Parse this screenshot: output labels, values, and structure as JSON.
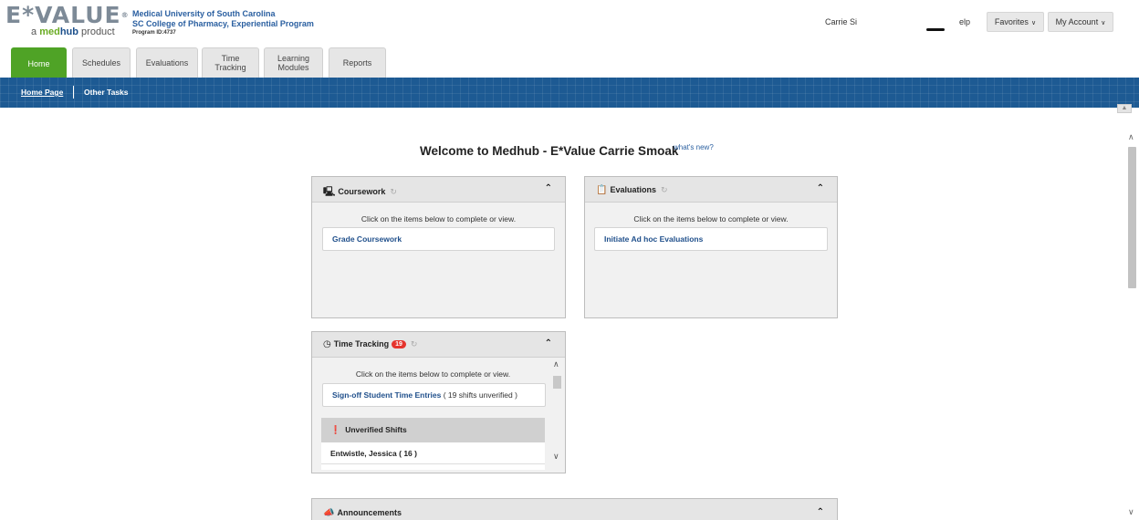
{
  "header": {
    "logo": {
      "main": "E*VALUE",
      "tm": "®",
      "sub_prefix": "a ",
      "sub_med": "med",
      "sub_hub": "hub",
      "sub_suffix": " product"
    },
    "org": {
      "line1": "Medical University of South Carolina",
      "line2": "SC College of Pharmacy, Experiential Program",
      "line3": "Program ID:4737"
    },
    "user_name": "Carrie Si",
    "help_label": "elp",
    "favorites_label": "Favorites",
    "account_label": "My Account"
  },
  "tabs": [
    {
      "label": "Home",
      "active": true
    },
    {
      "label": "Schedules"
    },
    {
      "label": "Evaluations"
    },
    {
      "label": "Time Tracking"
    },
    {
      "label": "Learning Modules"
    },
    {
      "label": "Reports"
    }
  ],
  "subnav": {
    "home_page": "Home Page",
    "other_tasks": "Other Tasks"
  },
  "welcome": {
    "title": "Welcome to Medhub - E*Value Carrie Smoak",
    "whats_new": "what's new?"
  },
  "panels": {
    "coursework": {
      "title": "Coursework",
      "instruction": "Click on the items below to complete or view.",
      "link": "Grade Coursework"
    },
    "evaluations": {
      "title": "Evaluations",
      "instruction": "Click on the items below to complete or view.",
      "link": "Initiate Ad hoc Evaluations"
    },
    "time_tracking": {
      "title": "Time Tracking",
      "badge": "19",
      "instruction": "Click on the items below to complete or view.",
      "link": "Sign-off Student Time Entries",
      "link_suffix": " ( 19 shifts unverified )",
      "unverified_header": "Unverified Shifts",
      "shift_row": "Entwistle, Jessica ( 16 )"
    },
    "announcements": {
      "title": "Announcements"
    }
  }
}
